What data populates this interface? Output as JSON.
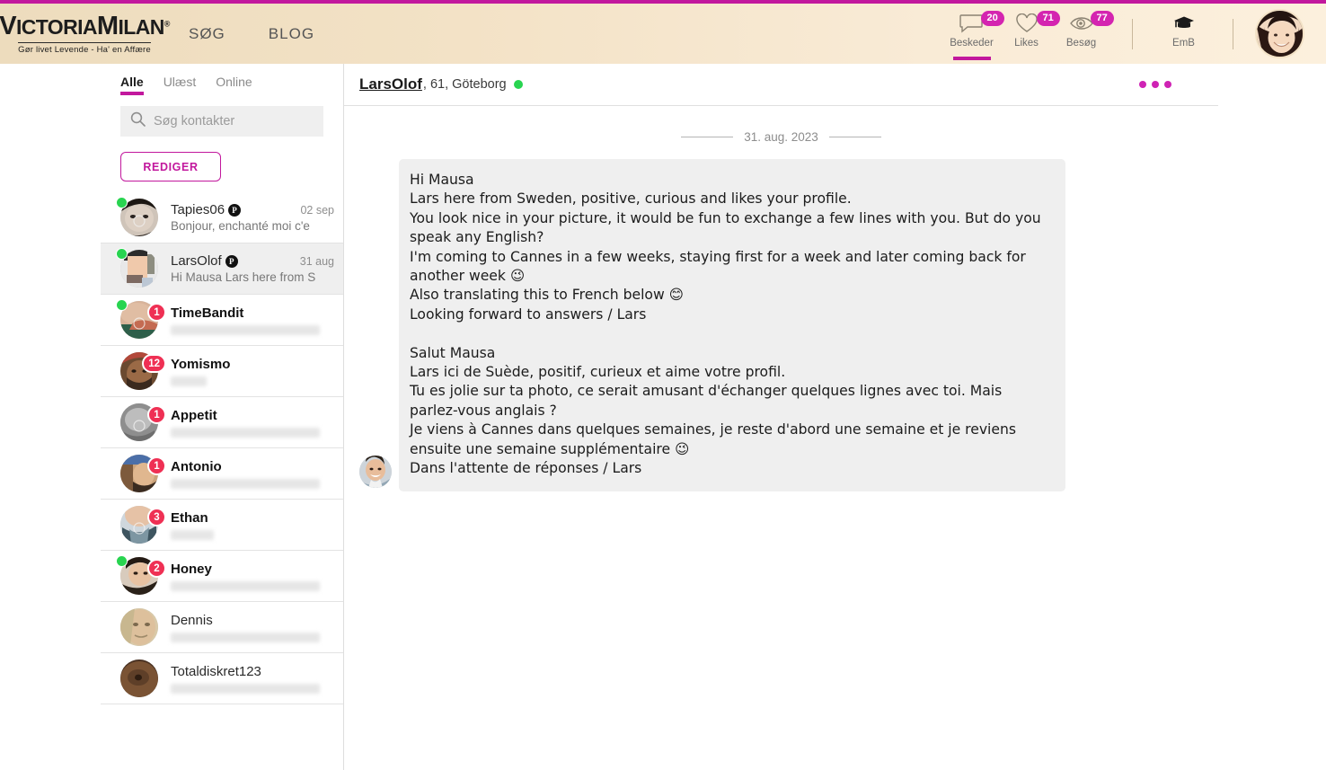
{
  "header": {
    "logo_main_1": "V",
    "logo_main_2": "ICTORIA",
    "logo_main_3": "M",
    "logo_main_4": "ILAN",
    "logo_reg": "®",
    "logo_tagline": "Gør livet Levende - Ha' en Affære",
    "nav": [
      {
        "label": "SØG",
        "name": "nav-sog"
      },
      {
        "label": "BLOG",
        "name": "nav-blog"
      }
    ],
    "stats": [
      {
        "label": "Beskeder",
        "count": "20",
        "icon": "chat-bubble-icon",
        "active": true
      },
      {
        "label": "Likes",
        "count": "71",
        "icon": "heart-icon",
        "active": false
      },
      {
        "label": "Besøg",
        "count": "77",
        "icon": "eye-icon",
        "active": false
      }
    ],
    "emb": {
      "label": "EmB",
      "icon": "graduation-cap-icon"
    },
    "accent_color": "#c2189d",
    "badge_color": "#d424b0"
  },
  "sidebar": {
    "tabs": [
      {
        "label": "Alle",
        "active": true
      },
      {
        "label": "Ulæst",
        "active": false
      },
      {
        "label": "Online",
        "active": false
      }
    ],
    "search": {
      "placeholder": "Søg kontakter",
      "value": ""
    },
    "edit_button": "REDIGER",
    "contacts": [
      {
        "name": "Tapies06",
        "preview": "Bonjour, enchanté moi c'e",
        "date": "02 sep",
        "online": true,
        "unread": "",
        "premium": true,
        "selected": false,
        "blurred": false,
        "bold": false
      },
      {
        "name": "LarsOlof",
        "preview": "Hi Mausa Lars here from S",
        "date": "31 aug",
        "online": true,
        "unread": "",
        "premium": true,
        "selected": true,
        "blurred": false,
        "bold": false
      },
      {
        "name": "TimeBandit",
        "preview": "",
        "date": "",
        "online": true,
        "unread": "1",
        "premium": false,
        "selected": false,
        "blurred": true,
        "bold": true
      },
      {
        "name": "Yomismo",
        "preview": "",
        "date": "",
        "online": false,
        "unread": "12",
        "premium": false,
        "selected": false,
        "blurred": true,
        "bold": true
      },
      {
        "name": "Appetit",
        "preview": "",
        "date": "",
        "online": false,
        "unread": "1",
        "premium": false,
        "selected": false,
        "blurred": true,
        "bold": true
      },
      {
        "name": "Antonio",
        "preview": "",
        "date": "",
        "online": false,
        "unread": "1",
        "premium": false,
        "selected": false,
        "blurred": true,
        "bold": true
      },
      {
        "name": "Ethan",
        "preview": "",
        "date": "",
        "online": false,
        "unread": "3",
        "premium": false,
        "selected": false,
        "blurred": true,
        "bold": true
      },
      {
        "name": "Honey",
        "preview": "",
        "date": "",
        "online": true,
        "unread": "2",
        "premium": false,
        "selected": false,
        "blurred": true,
        "bold": true
      },
      {
        "name": "Dennis",
        "preview": "",
        "date": "",
        "online": false,
        "unread": "",
        "premium": false,
        "selected": false,
        "blurred": true,
        "bold": false
      },
      {
        "name": "Totaldiskret123",
        "preview": "",
        "date": "",
        "online": false,
        "unread": "",
        "premium": false,
        "selected": false,
        "blurred": true,
        "bold": false
      }
    ]
  },
  "chat": {
    "partner_name": "LarsOlof",
    "partner_meta": ", 61, Göteborg",
    "partner_online": true,
    "more_menu": "•••",
    "date_separator": "31. aug. 2023",
    "message": "Hi Mausa\nLars here from Sweden, positive, curious and likes your profile.\nYou look nice in your picture, it would be fun to exchange a few lines with you. But do you speak any English?\nI'm coming to Cannes in a few weeks, staying first for a week and later coming back for another week 😉\nAlso translating this to French below 😊\nLooking forward to answers / Lars\n\nSalut Mausa\nLars ici de Suède, positif, curieux et aime votre profil.\nTu es jolie sur ta photo, ce serait amusant d'échanger quelques lignes avec toi. Mais parlez-vous anglais ?\nJe viens à Cannes dans quelques semaines, je reste d'abord une semaine et je reviens ensuite une semaine supplémentaire 😉\nDans l'attente de réponses / Lars"
  }
}
